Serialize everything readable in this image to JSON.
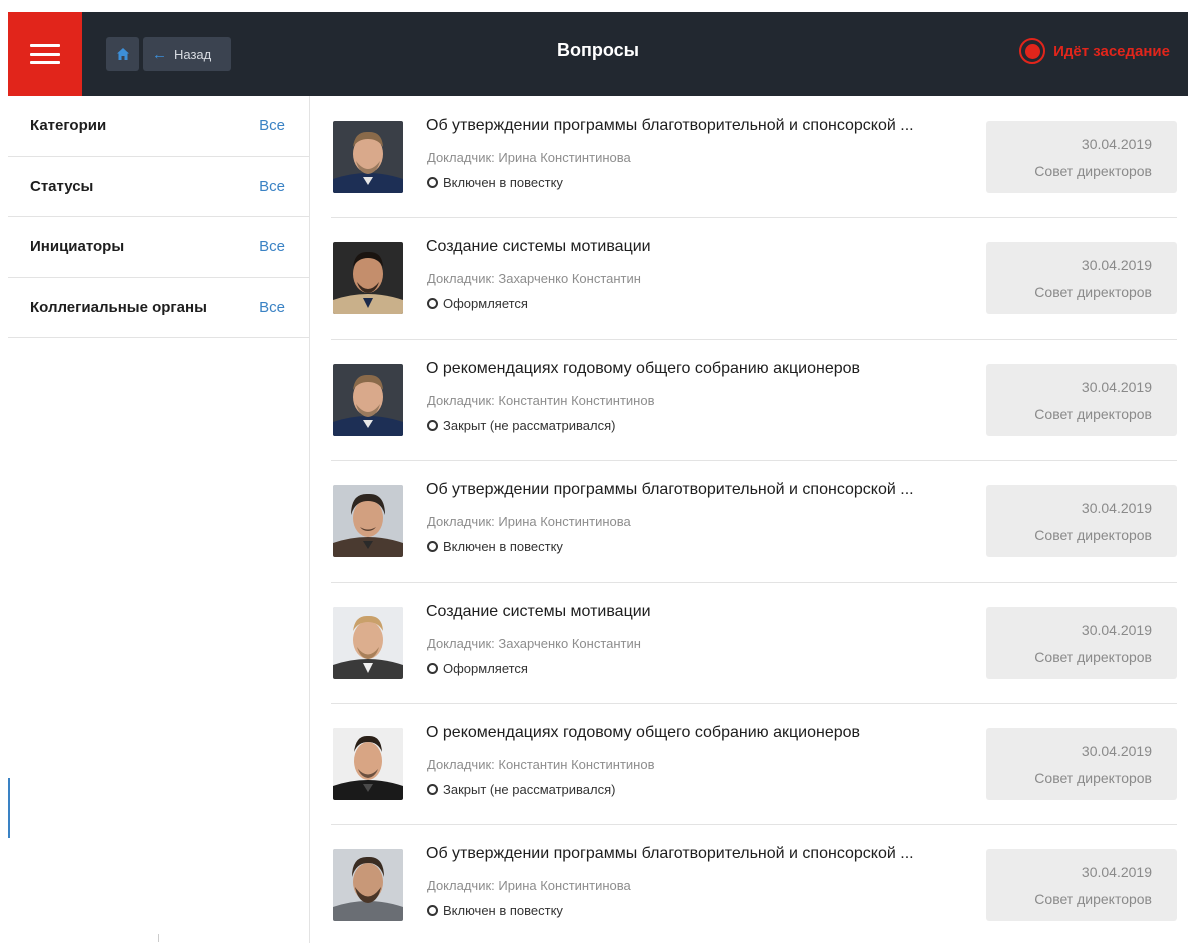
{
  "header": {
    "title": "Вопросы",
    "back_label": "Назад",
    "meeting_status": "Идёт заседание"
  },
  "colors": {
    "accent_red": "#e1251b",
    "header_bg": "#222830",
    "link_blue": "#3a82c4"
  },
  "icons": {
    "menu": "menu-icon",
    "home": "home-icon",
    "back": "arrow-left-icon",
    "meeting": "record-icon",
    "status": "circle-outline-icon"
  },
  "filters": [
    {
      "name": "Категории",
      "value": "Все"
    },
    {
      "name": "Статусы",
      "value": "Все"
    },
    {
      "name": "Инициаторы",
      "value": "Все"
    },
    {
      "name": "Коллегиальные органы",
      "value": "Все"
    }
  ],
  "questions": [
    {
      "title": "Об утверждении программы благотворительной и спонсорской ...",
      "reporter_label": "Докладчик:",
      "reporter": "Ирина Констинтинова",
      "status": "Включен в повестку",
      "date": "30.04.2019",
      "body": "Совет директоров"
    },
    {
      "title": "Создание системы мотивации",
      "reporter_label": "Докладчик:",
      "reporter": "Захарченко Константин",
      "status": "Оформляется",
      "date": "30.04.2019",
      "body": "Совет директоров"
    },
    {
      "title": "О рекомендациях годовому общего собранию акционеров",
      "reporter_label": "Докладчик:",
      "reporter": "Константин Констинтинов",
      "status": "Закрыт (не рассматривался)",
      "date": "30.04.2019",
      "body": "Совет директоров"
    },
    {
      "title": "Об утверждении программы благотворительной и спонсорской ...",
      "reporter_label": "Докладчик:",
      "reporter": "Ирина Констинтинова",
      "status": "Включен в повестку",
      "date": "30.04.2019",
      "body": "Совет директоров"
    },
    {
      "title": "Создание системы мотивации",
      "reporter_label": "Докладчик:",
      "reporter": "Захарченко Константин",
      "status": "Оформляется",
      "date": "30.04.2019",
      "body": "Совет директоров"
    },
    {
      "title": "О рекомендациях годовому общего собранию акционеров",
      "reporter_label": "Докладчик:",
      "reporter": "Константин Констинтинов",
      "status": "Закрыт (не рассматривался)",
      "date": "30.04.2019",
      "body": "Совет директоров"
    },
    {
      "title": "Об утверждении программы благотворительной и спонсорской ...",
      "reporter_label": "Докладчик:",
      "reporter": "Ирина Констинтинова",
      "status": "Включен в повестку",
      "date": "30.04.2019",
      "body": "Совет директоров"
    }
  ]
}
